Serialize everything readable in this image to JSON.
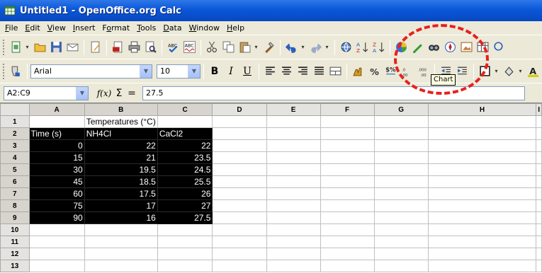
{
  "window": {
    "title": "Untitled1 - OpenOffice.org Calc"
  },
  "menu": {
    "items": [
      {
        "pre": "",
        "u": "F",
        "post": "ile"
      },
      {
        "pre": "",
        "u": "E",
        "post": "dit"
      },
      {
        "pre": "",
        "u": "V",
        "post": "iew"
      },
      {
        "pre": "",
        "u": "I",
        "post": "nsert"
      },
      {
        "pre": "F",
        "u": "o",
        "post": "rmat"
      },
      {
        "pre": "",
        "u": "T",
        "post": "ools"
      },
      {
        "pre": "",
        "u": "D",
        "post": "ata"
      },
      {
        "pre": "",
        "u": "W",
        "post": "indow"
      },
      {
        "pre": "",
        "u": "H",
        "post": "elp"
      }
    ]
  },
  "format_toolbar": {
    "font_name": "Arial",
    "font_size": "10"
  },
  "formula_bar": {
    "name_box": "A2:C9",
    "fx_label": "f(x)",
    "sum_label": "Σ",
    "equals_label": "=",
    "content": "27.5"
  },
  "tooltip": {
    "text": "Chart"
  },
  "grid": {
    "columns": [
      "A",
      "B",
      "C",
      "D",
      "E",
      "F",
      "G",
      "H",
      "I"
    ],
    "rows": [
      {
        "n": "1",
        "a": "",
        "b": "Temperatures (°C)",
        "c": ""
      },
      {
        "n": "2",
        "a": "Time (s)",
        "b": "NH4Cl",
        "c": "CaCl2"
      },
      {
        "n": "3",
        "a": "0",
        "b": "22",
        "c": "22"
      },
      {
        "n": "4",
        "a": "15",
        "b": "21",
        "c": "23.5"
      },
      {
        "n": "5",
        "a": "30",
        "b": "19.5",
        "c": "24.5"
      },
      {
        "n": "6",
        "a": "45",
        "b": "18.5",
        "c": "25.5"
      },
      {
        "n": "7",
        "a": "60",
        "b": "17.5",
        "c": "26"
      },
      {
        "n": "8",
        "a": "75",
        "b": "17",
        "c": "27"
      },
      {
        "n": "9",
        "a": "90",
        "b": "16",
        "c": "27.5"
      },
      {
        "n": "10",
        "a": "",
        "b": "",
        "c": ""
      },
      {
        "n": "11",
        "a": "",
        "b": "",
        "c": ""
      },
      {
        "n": "12",
        "a": "",
        "b": "",
        "c": ""
      },
      {
        "n": "13",
        "a": "",
        "b": "",
        "c": ""
      }
    ]
  },
  "colors": {
    "titlebar": "#0a57d8",
    "selection": "#000000",
    "highlight": "#e8201c"
  }
}
